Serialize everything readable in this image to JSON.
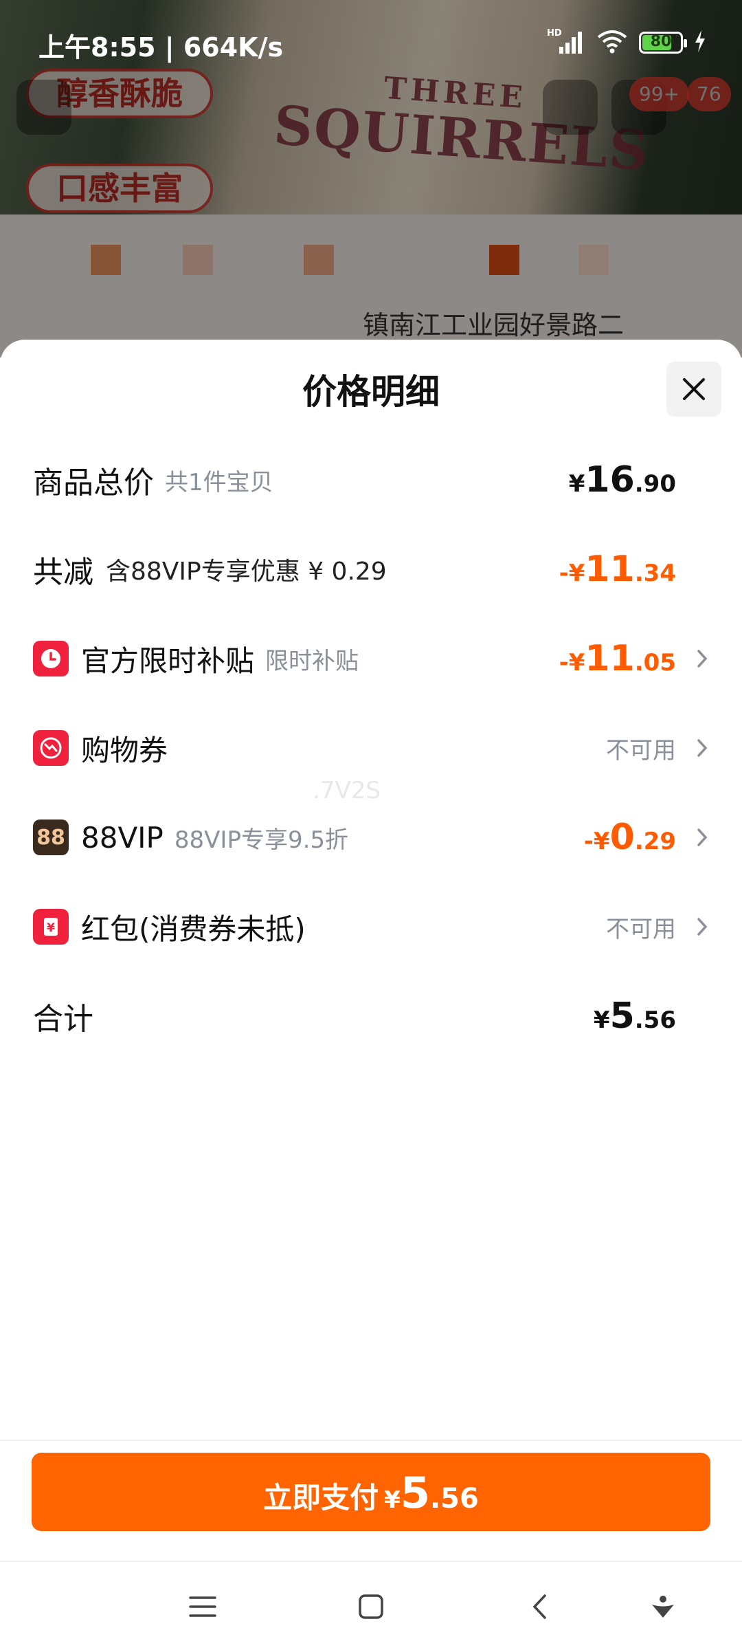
{
  "status_bar": {
    "time": "上午8:55 | 664K/s",
    "network": "HD",
    "battery": "80",
    "battery_level": 0.8
  },
  "background_page": {
    "brand_line1": "THREE",
    "brand_line2": "SQUIRRELS",
    "tag1": "醇香酥脆",
    "tag2": "口感丰富",
    "cart_badge": "99+",
    "badge2": "76",
    "address": "镇南江工业园好景路二"
  },
  "sheet": {
    "title": "价格明细",
    "close_icon": "close-icon"
  },
  "rows": {
    "total": {
      "label": "商品总价",
      "sub": "共1件宝贝",
      "currency": "¥",
      "int": "16",
      "dec": ".90"
    },
    "reduce": {
      "label": "共减",
      "sub": "含88VIP专享优惠 ¥ 0.29",
      "currency": "-¥",
      "int": "11",
      "dec": ".34"
    },
    "subsidy": {
      "label": "官方限时补贴",
      "sub": "限时补贴",
      "currency": "-¥",
      "int": "11",
      "dec": ".05",
      "icon": "clock-icon"
    },
    "coupon": {
      "label": "购物券",
      "value": "不可用",
      "icon": "coupon-icon"
    },
    "vip": {
      "label": "88VIP",
      "sub": "88VIP专享9.5折",
      "currency": "-¥",
      "int": "0",
      "dec": ".29",
      "icon_text": "88"
    },
    "redpack": {
      "label": "红包(消费券未抵)",
      "value": "不可用",
      "icon": "yen-envelope-icon"
    },
    "sum": {
      "label": "合计",
      "currency": "¥",
      "int": "5",
      "dec": ".56"
    }
  },
  "watermark": ".7V2S",
  "pay_button": {
    "label": "立即支付",
    "currency": "¥",
    "int": "5",
    "dec": ".56"
  },
  "colors": {
    "accent": "#ff6400",
    "discount": "#ff5b00",
    "icon_red": "#f0213d"
  }
}
